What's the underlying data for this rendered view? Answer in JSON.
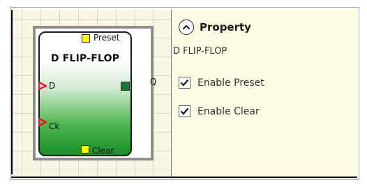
{
  "diagram": {
    "block": {
      "title": "D FLIP-FLOP",
      "pins": {
        "preset": "Preset",
        "d": "D",
        "ck": "Ck",
        "clear": "Clear",
        "q": "Q"
      },
      "colors": {
        "pin_control": "#ffff00",
        "pin_output": "#167a34",
        "pin_input_arrow": "#e8172c"
      }
    }
  },
  "property_panel": {
    "title": "Property",
    "subtitle": "D FLIP-FLOP",
    "collapse_icon": "chevron-up-icon",
    "options": [
      {
        "label": "Enable Preset",
        "checked": true
      },
      {
        "label": "Enable Clear",
        "checked": true
      }
    ],
    "background": "#fdfbe1"
  }
}
